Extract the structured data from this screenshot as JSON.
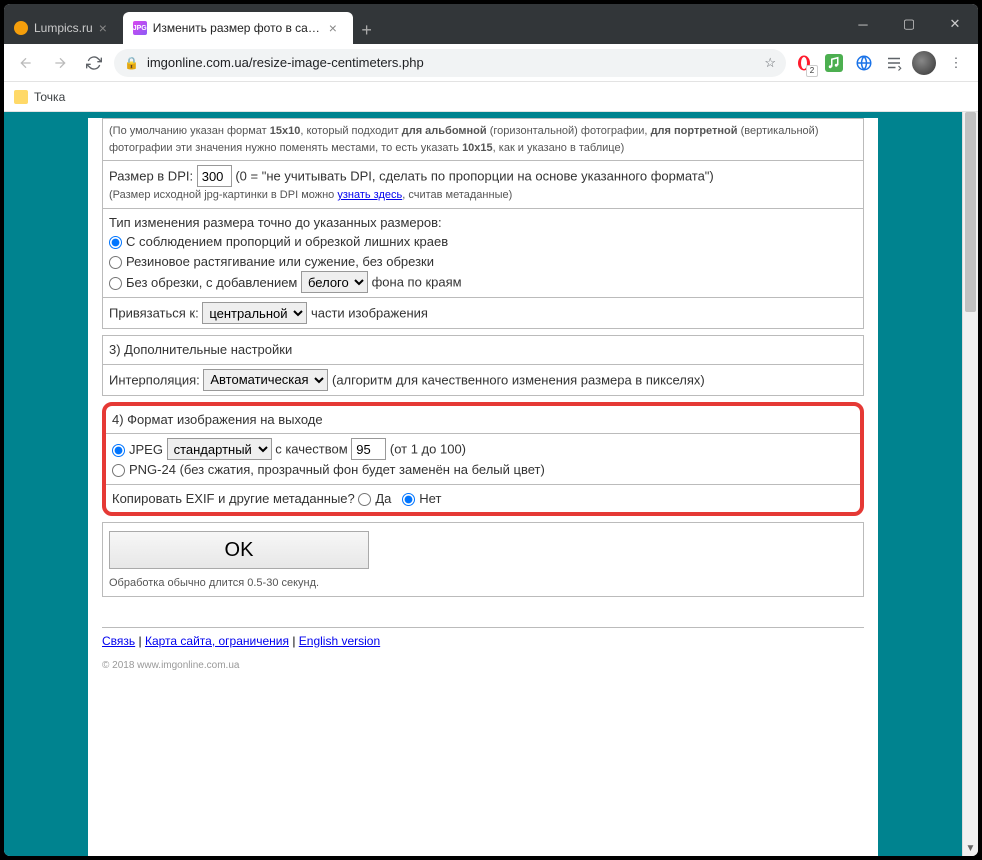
{
  "window": {
    "tabs": [
      {
        "title": "Lumpics.ru"
      },
      {
        "title": "Изменить размер фото в санти"
      }
    ]
  },
  "browser": {
    "url": "imgonline.com.ua/resize-image-centimeters.php",
    "bookmark": "Точка"
  },
  "section2": {
    "note_pre": "(По умолчанию указан формат ",
    "fmt1": "15x10",
    "note_mid1": ", который подходит ",
    "bold1": "для альбомной",
    "note_mid2": " (горизонтальной) фотографии, ",
    "bold2": "для портретной",
    "note_mid3": " (вертикальной) фотографии эти значения нужно поменять местами, то есть указать ",
    "fmt2": "10x15",
    "note_end": ", как и указано в таблице)",
    "dpi_label": "Размер в DPI:",
    "dpi_value": "300",
    "dpi_hint": "(0 = \"не учитывать DPI, сделать по пропорции на основе указанного формата\")",
    "dpi_sub_pre": "(Размер исходной jpg-картинки в DPI можно ",
    "dpi_link": "узнать здесь",
    "dpi_sub_post": ", считав метаданные)",
    "resize_label": "Тип изменения размера точно до указанных размеров:",
    "opt1": "С соблюдением пропорций и обрезкой лишних краев",
    "opt2": "Резиновое растягивание или сужение, без обрезки",
    "opt3_pre": "Без обрезки, с добавлением ",
    "opt3_select": "белого",
    "opt3_post": " фона по краям",
    "anchor_label": "Привязаться к: ",
    "anchor_select": "центральной",
    "anchor_post": " части изображения"
  },
  "section3": {
    "title": "3) Дополнительные настройки",
    "interp_label": "Интерполяция: ",
    "interp_select": "Автоматическая",
    "interp_hint": " (алгоритм для качественного изменения размера в пикселях)"
  },
  "section4": {
    "title": "4) Формат изображения на выходе",
    "jpeg_label": "JPEG",
    "jpeg_select": "стандартный",
    "jpeg_mid": " с качеством ",
    "jpeg_quality": "95",
    "jpeg_hint": " (от 1 до 100)",
    "png_label": "PNG-24 (без сжатия, прозрачный фон будет заменён на белый цвет)",
    "exif_label": "Копировать EXIF и другие метаданные?  ",
    "exif_yes": "Да",
    "exif_no": "Нет"
  },
  "submit": {
    "ok": "OK",
    "hint": "Обработка обычно длится 0.5-30 секунд."
  },
  "footer": {
    "link1": "Связь",
    "sep": " | ",
    "link2": "Карта сайта, ограничения",
    "link3": "English version",
    "copy": "© 2018 www.imgonline.com.ua"
  }
}
